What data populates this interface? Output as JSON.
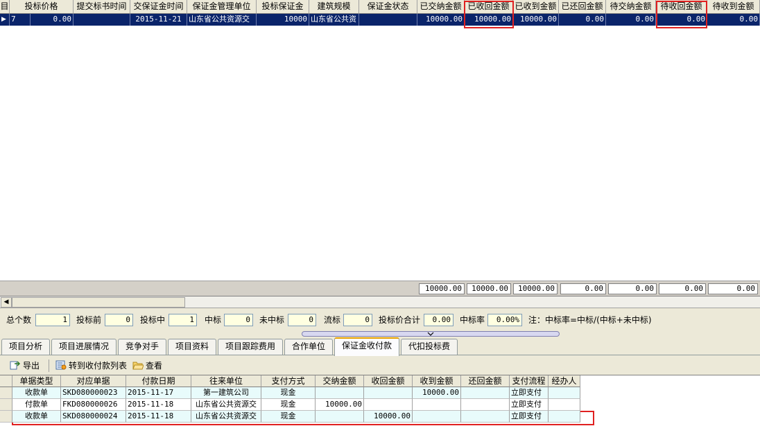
{
  "top_grid": {
    "columns": [
      "目",
      "投标价格",
      "提交标书时间",
      "交保证金时间",
      "保证金管理单位",
      "投标保证金",
      "建筑规模",
      "保证金状态",
      "已交纳金额",
      "已收回金额",
      "已收到金额",
      "已还回金额",
      "待交纳金额",
      "待收回金额",
      "待收到金额"
    ],
    "row": {
      "indicator": "▶",
      "cells": [
        "7",
        "0.00",
        "",
        "2015-11-21",
        "山东省公共资源交",
        "10000",
        "山东省公共资",
        "",
        "10000.00",
        "10000.00",
        "10000.00",
        "0.00",
        "0.00",
        "0.00",
        "0.00"
      ]
    },
    "totals": [
      "10000.00",
      "10000.00",
      "10000.00",
      "0.00",
      "0.00",
      "0.00",
      "0.00"
    ]
  },
  "scrollbar": {
    "left_arrow": "◀"
  },
  "stats": {
    "items": [
      {
        "label": "总个数",
        "value": "1"
      },
      {
        "label": "投标前",
        "value": "0"
      },
      {
        "label": "投标中",
        "value": "1"
      },
      {
        "label": "中标",
        "value": "0"
      },
      {
        "label": "未中标",
        "value": "0"
      },
      {
        "label": "流标",
        "value": "0"
      },
      {
        "label": "投标价合计",
        "value": "0.00"
      },
      {
        "label": "中标率",
        "value": "0.00%"
      }
    ],
    "note": "注：中标率=中标/(中标+未中标)"
  },
  "tabs": [
    "项目分析",
    "项目进展情况",
    "竞争对手",
    "项目资料",
    "项目跟踪费用",
    "合作单位",
    "保证金收付款",
    "代扣投标费"
  ],
  "active_tab": "保证金收付款",
  "toolbar": {
    "export": "导出",
    "to_list": "转到收付款列表",
    "view": "查看"
  },
  "bottom_grid": {
    "columns": [
      "单据类型",
      "对应单据",
      "付款日期",
      "往来单位",
      "支付方式",
      "交纳金额",
      "收回金额",
      "收到金额",
      "还回金额",
      "支付流程",
      "经办人"
    ],
    "rows": [
      [
        "收款单",
        "SKD080000023",
        "2015-11-17",
        "第一建筑公司",
        "现金",
        "",
        "",
        "10000.00",
        "",
        "立即支付",
        ""
      ],
      [
        "付款单",
        "FKD080000026",
        "2015-11-18",
        "山东省公共资源交",
        "现金",
        "10000.00",
        "",
        "",
        "",
        "立即支付",
        ""
      ],
      [
        "收款单",
        "SKD080000024",
        "2015-11-18",
        "山东省公共资源交",
        "现金",
        "",
        "10000.00",
        "",
        "",
        "立即支付",
        ""
      ]
    ]
  },
  "colors": {
    "selection": "#0a246a",
    "highlight_row": "#e8fbfb",
    "annotation": "#e02020",
    "input_bg": "#ffffe1"
  }
}
